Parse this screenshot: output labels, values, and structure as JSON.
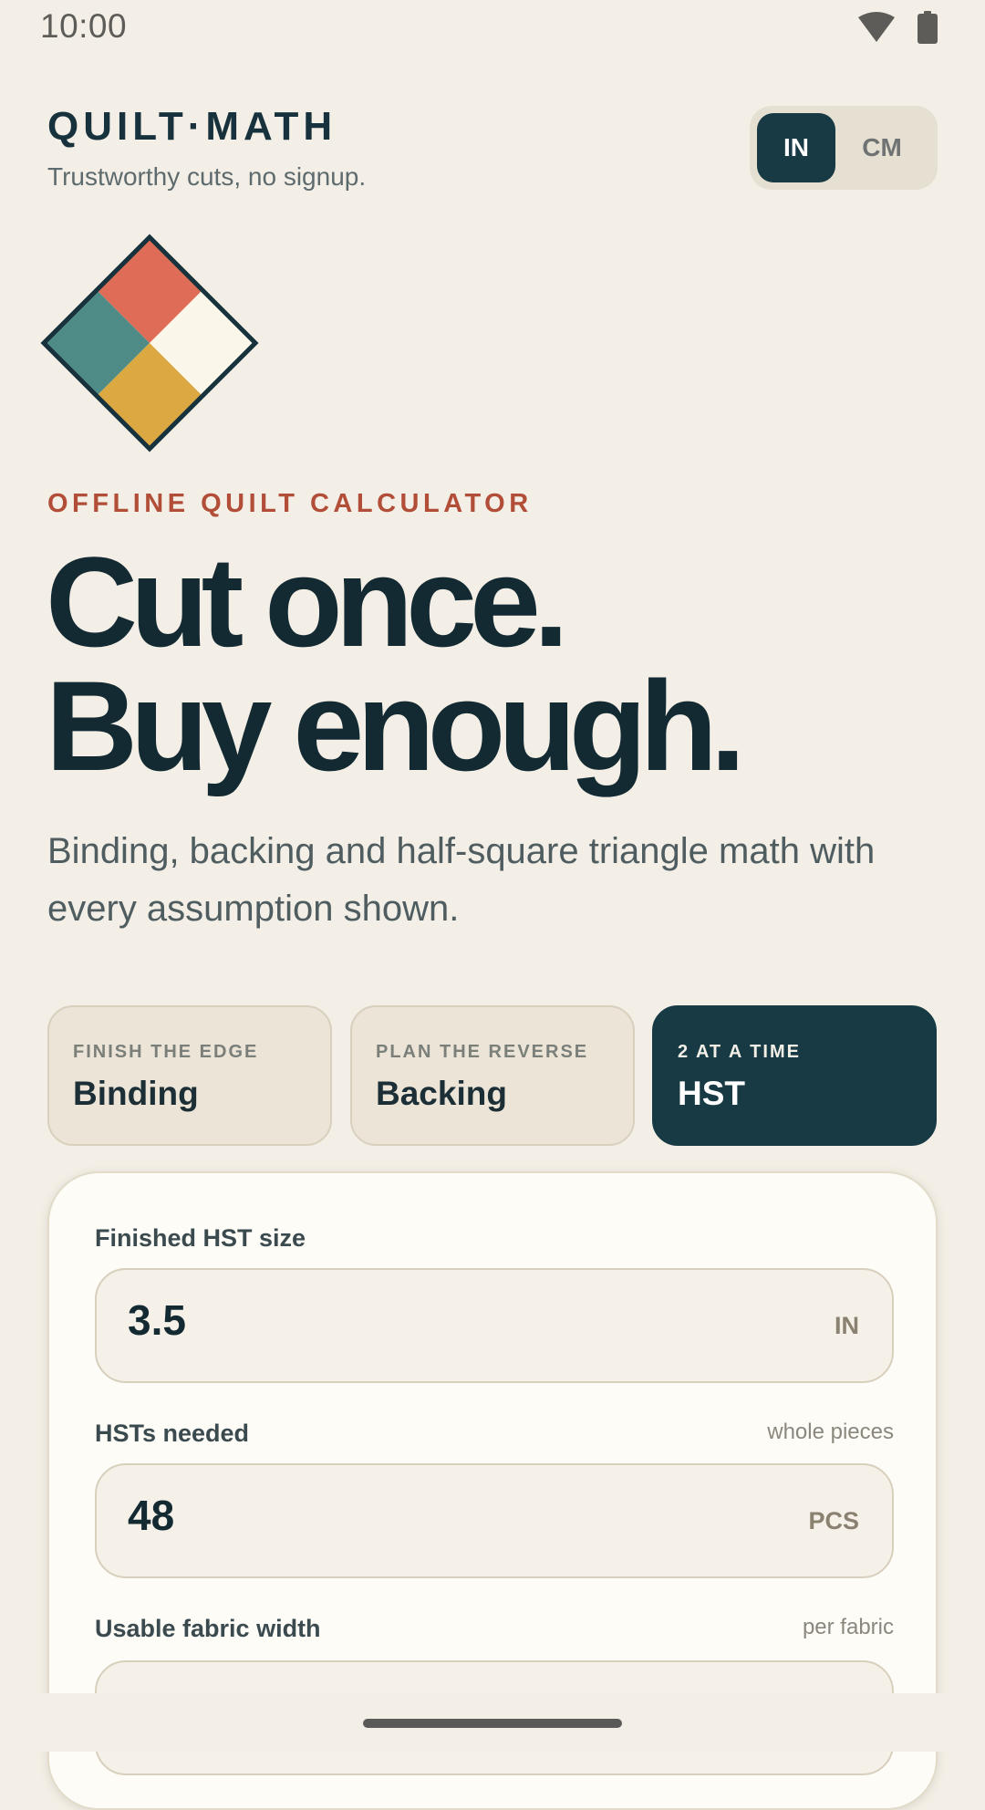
{
  "status_bar": {
    "time": "10:00",
    "icons": [
      "wifi-icon",
      "battery-icon"
    ]
  },
  "header": {
    "brand": "QUILT·MATH",
    "tagline": "Trustworthy cuts, no signup.",
    "unit_toggle": {
      "options": [
        "IN",
        "CM"
      ],
      "selected": "IN"
    }
  },
  "logo": {
    "icon": "quilt-block-logo",
    "colors": {
      "top": "#de6c56",
      "left": "#4f8b87",
      "right": "#fbf6ea",
      "bottom": "#dca842",
      "outline": "#17323c"
    }
  },
  "hero": {
    "eyebrow": "OFFLINE QUILT CALCULATOR",
    "headline_line1": "Cut once.",
    "headline_line2": "Buy enough.",
    "subtitle": "Binding, backing and half-square triangle math with every assumption shown."
  },
  "modes": [
    {
      "kicker": "FINISH THE EDGE",
      "title": "Binding",
      "selected": false
    },
    {
      "kicker": "PLAN THE REVERSE",
      "title": "Backing",
      "selected": false
    },
    {
      "kicker": "2 AT A TIME",
      "title": "HST",
      "selected": true
    }
  ],
  "calculator": {
    "fields": [
      {
        "label": "Finished HST size",
        "hint": "",
        "value": "3.5",
        "unit": "IN"
      },
      {
        "label": "HSTs needed",
        "hint": "whole pieces",
        "value": "48",
        "unit": "PCS"
      },
      {
        "label": "Usable fabric width",
        "hint": "per fabric",
        "value": "",
        "unit": ""
      }
    ]
  },
  "colors": {
    "background": "#f3efe6",
    "accent": "#173a44",
    "eyebrow": "#b24d38",
    "panel": "#fdfcf7"
  }
}
